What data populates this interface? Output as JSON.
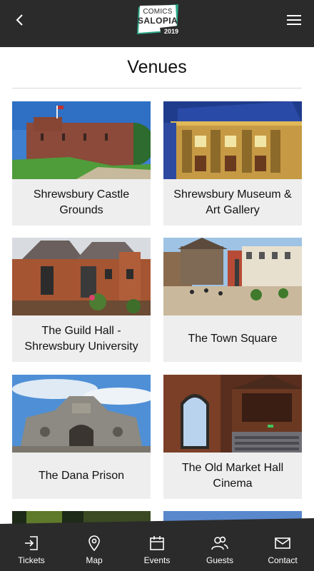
{
  "header": {
    "logo_line1": "COMICS",
    "logo_line2": "SALOPIA",
    "logo_year": "2019",
    "logo_accent": "#2aa889",
    "logo_accent2": "#d6337a"
  },
  "page": {
    "title": "Venues"
  },
  "venues": [
    {
      "name": "Shrewsbury Castle Grounds"
    },
    {
      "name": "Shrewsbury Museum & Art Gallery"
    },
    {
      "name": "The Guild Hall - Shrewsbury University"
    },
    {
      "name": "The Town Square"
    },
    {
      "name": "The Dana Prison"
    },
    {
      "name": "The Old Market Hall Cinema"
    }
  ],
  "bottom_nav": [
    {
      "label": "Tickets",
      "icon": "ticket-login-icon"
    },
    {
      "label": "Map",
      "icon": "map-pin-icon"
    },
    {
      "label": "Events",
      "icon": "calendar-icon"
    },
    {
      "label": "Guests",
      "icon": "guests-icon"
    },
    {
      "label": "Contact",
      "icon": "envelope-icon"
    }
  ],
  "colors": {
    "bar": "#2b2b2b",
    "card_bg": "#eeeeee"
  }
}
